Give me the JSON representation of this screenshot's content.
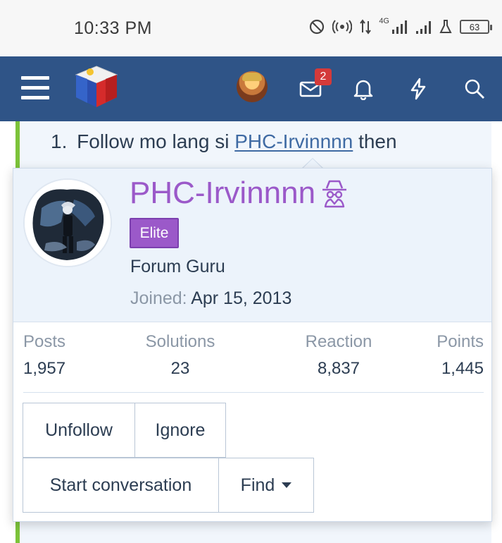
{
  "status_bar": {
    "time": "10:33 PM",
    "network": "4G",
    "battery": "63"
  },
  "header": {
    "menu_icon": "hamburger-icon",
    "logo_icon": "site-logo",
    "inbox_badge": "2",
    "icons": [
      "avatar",
      "envelope-icon",
      "bell-icon",
      "bolt-icon",
      "search-icon"
    ]
  },
  "post": {
    "number": "1.",
    "before": "Follow mo lang si",
    "link": "PHC-Irvinnnn",
    "after": "then"
  },
  "member_card": {
    "username": "PHC-Irvinnnn",
    "banner": "Elite",
    "user_title": "Forum Guru",
    "joined_label": "Joined:",
    "joined_value": "Apr 15, 2013",
    "stats": [
      {
        "label": "Posts",
        "value": "1,957"
      },
      {
        "label": "Solutions",
        "value": "23"
      },
      {
        "label": "Reaction",
        "value": "8,837"
      },
      {
        "label": "Points",
        "value": "1,445"
      }
    ],
    "buttons": {
      "unfollow": "Unfollow",
      "ignore": "Ignore",
      "start_conversation": "Start conversation",
      "find": "Find"
    }
  },
  "colors": {
    "header_bg": "#2f5487",
    "username": "#9b59c9",
    "accent_strip": "#7cc33a",
    "badge": "#d43a3a"
  }
}
